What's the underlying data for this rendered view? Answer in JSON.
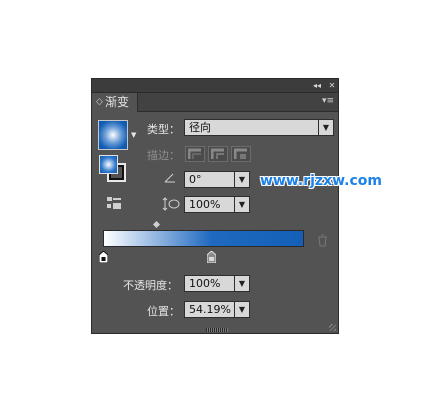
{
  "panel": {
    "title": "渐变",
    "collapse_glyph": "◂◂",
    "close_glyph": "✕",
    "tab_arrows": "◇",
    "menu_icon": "▾≡"
  },
  "gradient": {
    "type_label": "类型：",
    "type_value": "径向",
    "stroke_label": "描边：",
    "angle_value": "0°",
    "aspect_value": "100%",
    "opacity_label": "不透明度：",
    "opacity_value": "100%",
    "location_label": "位置：",
    "location_value": "54.19%",
    "start_color": "#ffffff",
    "end_color": "#1460b8",
    "selected_stop_location": 54.19
  },
  "watermark": {
    "text": "www.rjzxw.com",
    "color": "#1c82e8"
  }
}
